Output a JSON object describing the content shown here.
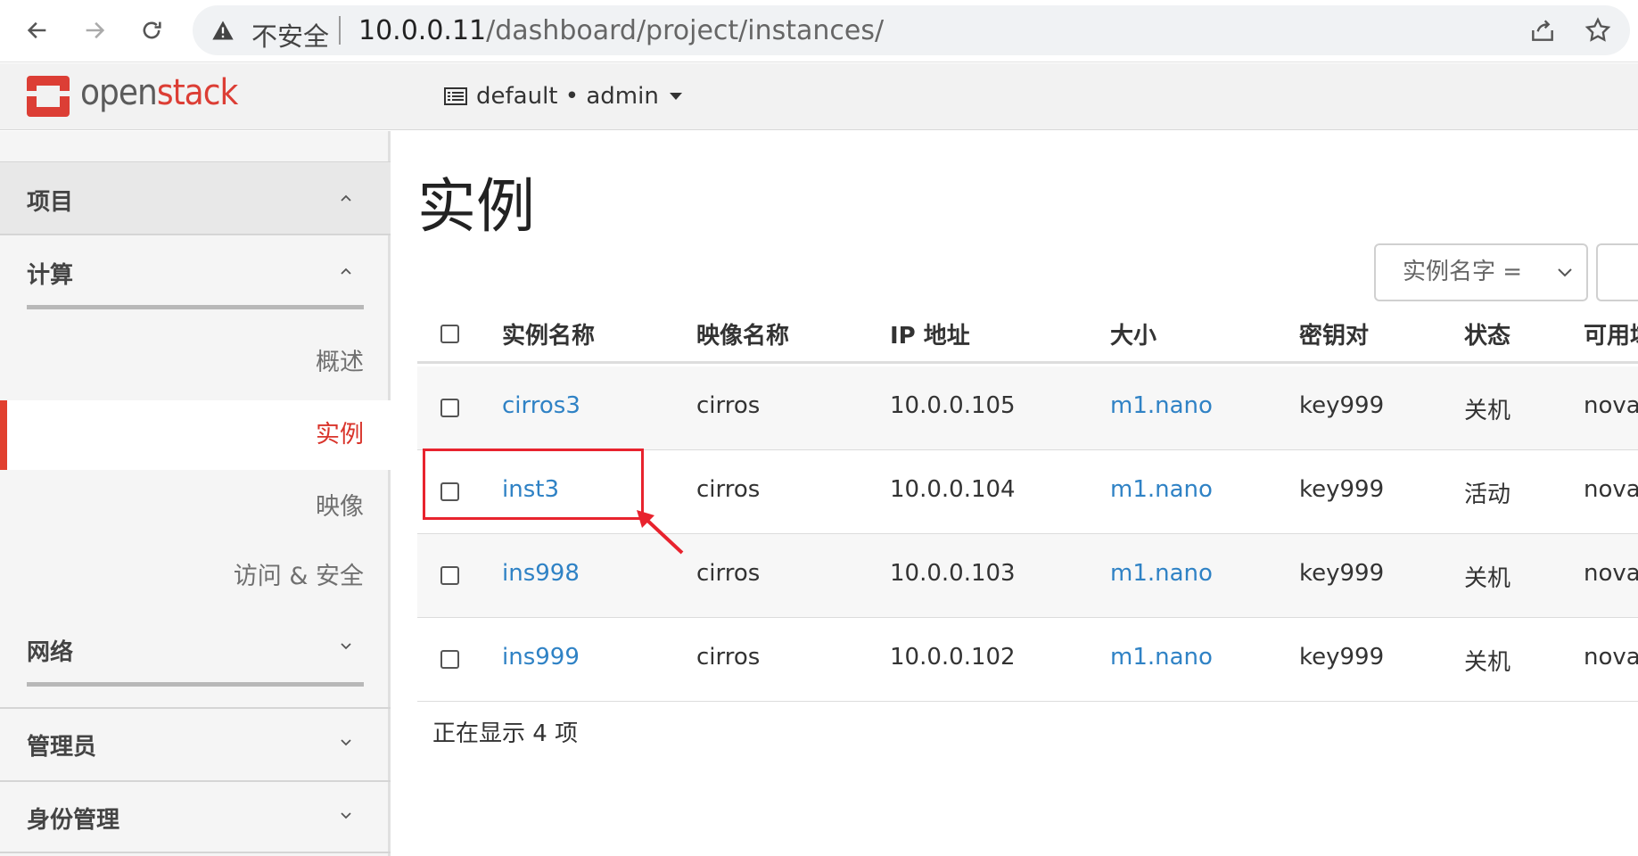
{
  "browser": {
    "insecure_label": "不安全",
    "url_host": "10.0.0.11",
    "url_path": "/dashboard/project/instances/"
  },
  "header": {
    "logo_open": "open",
    "logo_stack": "stack",
    "project_label": "default • admin"
  },
  "sidebar": {
    "project": "项目",
    "compute": "计算",
    "items": [
      "概述",
      "实例",
      "映像",
      "访问 & 安全"
    ],
    "active_item": "实例",
    "network": "网络",
    "admin": "管理员",
    "identity": "身份管理"
  },
  "main": {
    "title": "实例",
    "filter_select": "实例名字 =",
    "columns": [
      "实例名称",
      "映像名称",
      "IP 地址",
      "大小",
      "密钥对",
      "状态",
      "可用域"
    ],
    "rows": [
      {
        "name": "cirros3",
        "image": "cirros",
        "ip": "10.0.0.105",
        "size": "m1.nano",
        "key": "key999",
        "status": "关机",
        "zone": "nova"
      },
      {
        "name": "inst3",
        "image": "cirros",
        "ip": "10.0.0.104",
        "size": "m1.nano",
        "key": "key999",
        "status": "活动",
        "zone": "nova"
      },
      {
        "name": "ins998",
        "image": "cirros",
        "ip": "10.0.0.103",
        "size": "m1.nano",
        "key": "key999",
        "status": "关机",
        "zone": "nova"
      },
      {
        "name": "ins999",
        "image": "cirros",
        "ip": "10.0.0.102",
        "size": "m1.nano",
        "key": "key999",
        "status": "关机",
        "zone": "nova"
      }
    ],
    "count_label": "正在显示 4 项"
  },
  "colors": {
    "accent": "#dc3e35",
    "link": "#2f82c5",
    "annotation": "#e8232e"
  }
}
